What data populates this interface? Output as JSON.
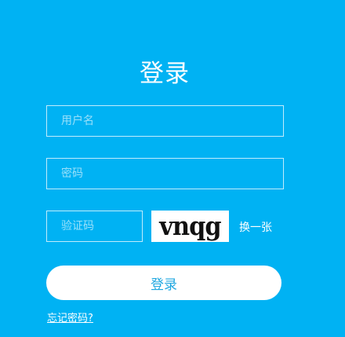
{
  "form": {
    "title": "登录",
    "username": {
      "placeholder": "用户名",
      "value": ""
    },
    "password": {
      "placeholder": "密码",
      "value": ""
    },
    "captcha": {
      "placeholder": "验证码",
      "value": "",
      "image_text": "vnqg",
      "refresh_label": "换一张"
    },
    "submit_label": "登录",
    "forgot_password_label": "忘记密码?"
  },
  "colors": {
    "background": "#00b2f3",
    "button_background": "#ffffff",
    "button_text": "#1fa7e0"
  }
}
